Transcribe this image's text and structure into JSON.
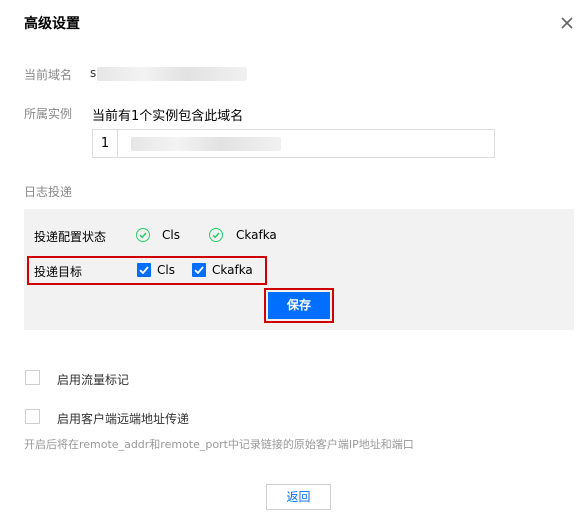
{
  "dialog": {
    "title": "高级设置"
  },
  "domain": {
    "label": "当前域名",
    "value_prefix": "s"
  },
  "instance": {
    "label": "所属实例",
    "summary": "当前有1个实例包含此域名",
    "index": "1"
  },
  "log_delivery": {
    "label": "日志投递",
    "status_label": "投递配置状态",
    "status_items": [
      "Cls",
      "Ckafka"
    ],
    "target_label": "投递目标",
    "target_items": [
      "Cls",
      "Ckafka"
    ],
    "save_label": "保存"
  },
  "options": {
    "traffic_mark": "启用流量标记",
    "client_remote": "启用客户端远端地址传递",
    "hint": "开启后将在remote_addr和remote_port中记录链接的原始客户端IP地址和端口"
  },
  "footer": {
    "back_label": "返回"
  },
  "colors": {
    "accent": "#006eff",
    "success": "#29cc6a",
    "highlight": "#d10000"
  }
}
